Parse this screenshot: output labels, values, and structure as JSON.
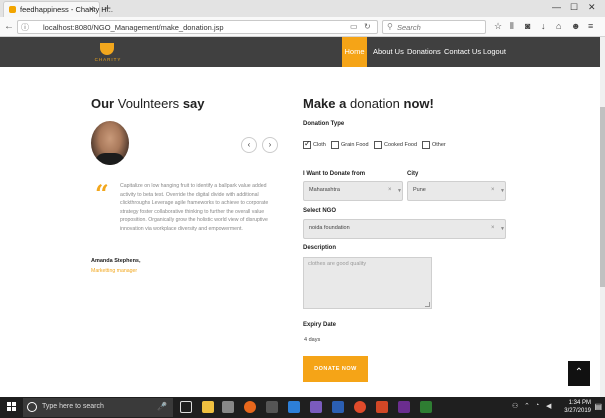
{
  "browser": {
    "tab_title": "feedhappiness - Charity H...",
    "url": "localhost:8080/NGO_Management/make_donation.jsp",
    "search_placeholder": "Search"
  },
  "nav": {
    "logo_text": "CHARITY",
    "items": [
      "Home",
      "About Us",
      "Donations",
      "Contact Us",
      "Logout"
    ],
    "active_item": "Home",
    "accent_color": "#f5a417"
  },
  "volunteers": {
    "title_bold": "Our",
    "title_light": "Voulnteers",
    "title_end": "say",
    "quote": "Capitalize on low hanging fruit to identify a ballpark value added activity to beta test. Override the digital divide with additional clickthroughs Leverage agile frameworks to achieve to corporate strategy foster collaborative thinking to further the overall value proposition. Organically grow the holistic world view of disruptive innovation via workplace diversity and empowerment.",
    "author": "Amanda Stephens,",
    "role": "Marketting manager"
  },
  "donation": {
    "title_a": "Make a",
    "title_b": "donation",
    "title_c": "now!",
    "type_label": "Donation Type",
    "types": [
      {
        "label": "Cloth",
        "checked": true
      },
      {
        "label": "Grain Food",
        "checked": false
      },
      {
        "label": "Cooked Food",
        "checked": false
      },
      {
        "label": "Other",
        "checked": false
      }
    ],
    "from_label": "I Want to Donate from",
    "from_value": "Maharashtra",
    "city_label": "City",
    "city_value": "Pune",
    "ngo_label": "Select NGO",
    "ngo_value": "noida foundation",
    "desc_label": "Description",
    "desc_value": "clothes are good quality",
    "expiry_label": "Expiry Date",
    "expiry_value": "4 days",
    "button": "DONATE NOW"
  },
  "taskbar": {
    "search_placeholder": "Type here to search",
    "time": "1:34 PM",
    "date": "3/27/2019"
  }
}
